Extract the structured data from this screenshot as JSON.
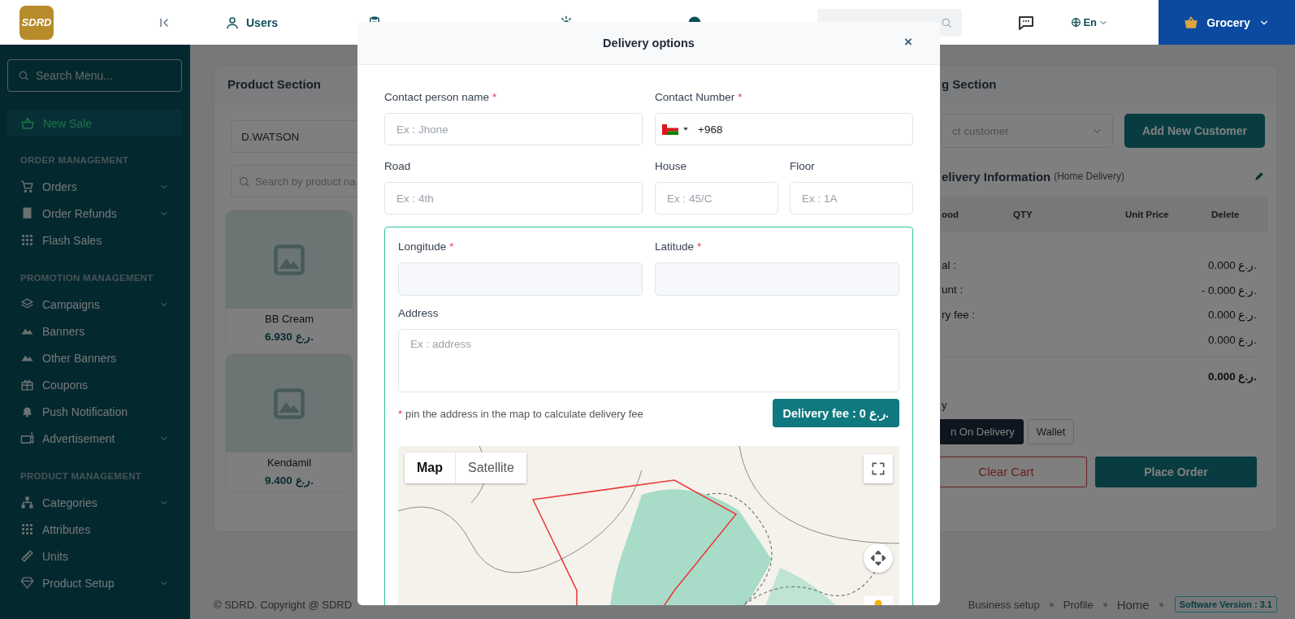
{
  "topbar": {
    "logo": "SDRD",
    "nav": [
      {
        "label": "Users"
      }
    ],
    "language": "En",
    "store": "Grocery"
  },
  "sidebar": {
    "search_placeholder": "Search Menu...",
    "new_sale": {
      "label": "New Sale",
      "selected": true
    },
    "sections": [
      {
        "title": "ORDER MANAGEMENT",
        "items": [
          {
            "label": "Orders",
            "expandable": true
          },
          {
            "label": "Order Refunds",
            "expandable": true
          },
          {
            "label": "Flash Sales",
            "expandable": false
          }
        ]
      },
      {
        "title": "PROMOTION MANAGEMENT",
        "items": [
          {
            "label": "Campaigns",
            "expandable": true
          },
          {
            "label": "Banners",
            "expandable": false
          },
          {
            "label": "Other Banners",
            "expandable": false
          },
          {
            "label": "Coupons",
            "expandable": false
          },
          {
            "label": "Push Notification",
            "expandable": false
          },
          {
            "label": "Advertisement",
            "expandable": true
          }
        ]
      },
      {
        "title": "PRODUCT MANAGEMENT",
        "items": [
          {
            "label": "Categories",
            "expandable": true
          },
          {
            "label": "Attributes",
            "expandable": false
          },
          {
            "label": "Units",
            "expandable": false
          },
          {
            "label": "Product Setup",
            "expandable": true
          }
        ]
      }
    ]
  },
  "product_section": {
    "title": "Product Section",
    "store": "D.WATSON",
    "search_placeholder": "Search by product na",
    "products": [
      {
        "name": "BB Cream",
        "price": "6.930 ر.ع."
      },
      {
        "name": "Kendamil",
        "price": "9.400 ر.ع."
      }
    ]
  },
  "billing_section": {
    "title": "g Section",
    "customer_placeholder": "ct customer",
    "add_customer": "Add New Customer",
    "delivery_title": "elivery Information",
    "delivery_type": "(Home Delivery)",
    "columns": [
      "ood",
      "QTY",
      "Unit Price",
      "Delete"
    ],
    "summary": [
      {
        "label": "al :",
        "value": "0.000 ر.ع."
      },
      {
        "label": "unt :",
        "value": "- 0.000 ر.ع."
      },
      {
        "label": "ry fee :",
        "value": "0.000 ر.ع."
      },
      {
        "value": "0.000 ر.ع."
      }
    ],
    "total": "0.000 ر.ع.",
    "payment_label": "y",
    "payment_methods": [
      {
        "label": "n On Delivery",
        "selected": true
      },
      {
        "label": "Wallet",
        "selected": false
      }
    ],
    "clear_cart": "Clear Cart",
    "place_order": "Place Order"
  },
  "footer": {
    "copyright": "© SDRD. Copyright @ SDRD",
    "links": [
      "Business setup",
      "Profile",
      "Home"
    ],
    "version": "Software Version : 3.1"
  },
  "modal": {
    "title": "Delivery options",
    "close": "×",
    "contact_name": {
      "label": "Contact person name",
      "required_mark": "*",
      "placeholder": "Ex : Jhone"
    },
    "contact_number": {
      "label": "Contact Number",
      "required_mark": "*",
      "value": "+968"
    },
    "road": {
      "label": "Road",
      "placeholder": "Ex : 4th"
    },
    "house": {
      "label": "House",
      "placeholder": "Ex : 45/C"
    },
    "floor": {
      "label": "Floor",
      "placeholder": "Ex : 1A"
    },
    "longitude": {
      "label": "Longitude",
      "required_mark": "*"
    },
    "latitude": {
      "label": "Latitude",
      "required_mark": "*"
    },
    "address": {
      "label": "Address",
      "placeholder": "Ex : address"
    },
    "note_mark": "*",
    "note": "pin the address in the map to calculate delivery fee",
    "delivery_fee": "Delivery fee : 0 ر.ع.",
    "map_types": [
      {
        "label": "Map",
        "selected": true
      },
      {
        "label": "Satellite",
        "selected": false
      }
    ]
  }
}
